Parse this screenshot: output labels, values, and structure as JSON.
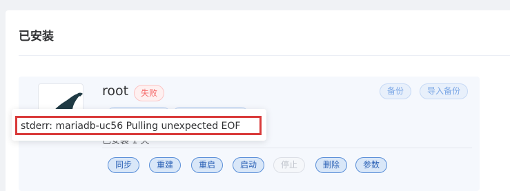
{
  "section": {
    "title": "已安装"
  },
  "app": {
    "name": "root",
    "status": "失败",
    "installed_text": "已安装 1 天",
    "logo_icon": "mariadb-seal-icon",
    "top_actions": {
      "backup": "备份",
      "import_backup": "导入备份"
    },
    "actions": [
      {
        "label": "同步",
        "disabled": false
      },
      {
        "label": "重建",
        "disabled": false
      },
      {
        "label": "重启",
        "disabled": false
      },
      {
        "label": "启动",
        "disabled": false
      },
      {
        "label": "停止",
        "disabled": true
      },
      {
        "label": "删除",
        "disabled": false
      },
      {
        "label": "参数",
        "disabled": false
      }
    ]
  },
  "tooltip": {
    "message": "stderr: mariadb-uc56 Pulling unexpected EOF"
  },
  "colors": {
    "error": "#f56c6c",
    "primary": "#2f64b7",
    "highlight_box": "#d93a3a",
    "card_bg": "#f5f8fd"
  }
}
